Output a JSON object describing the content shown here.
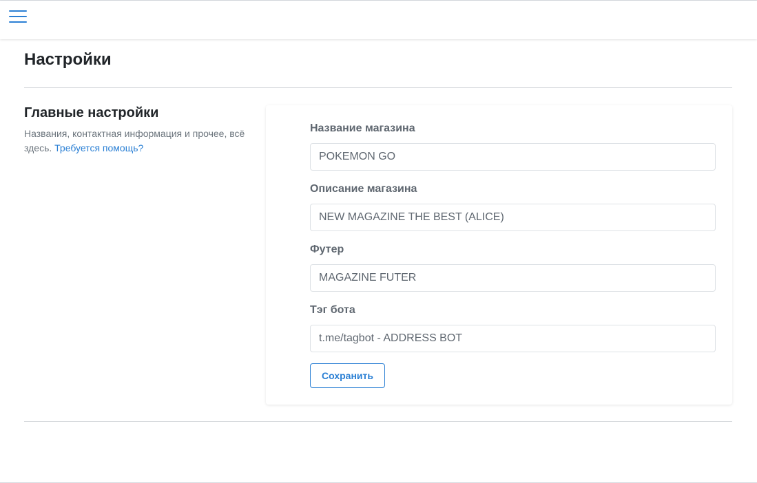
{
  "header": {
    "menu_icon": "hamburger-menu-icon"
  },
  "page": {
    "title": "Настройки"
  },
  "section": {
    "title": "Главные настройки",
    "description": "Названия, контактная информация и прочее, всё здесь.",
    "help_link": "Требуется помощь?"
  },
  "form": {
    "fields": [
      {
        "label": "Название магазина",
        "value": "POKEMON GO"
      },
      {
        "label": "Описание магазина",
        "value": "NEW MAGAZINE THE BEST (ALICE)"
      },
      {
        "label": "Футер",
        "value": "MAGAZINE FUTER"
      },
      {
        "label": "Тэг бота",
        "value": "t.me/tagbot - ADDRESS BOT"
      }
    ],
    "save_label": "Сохранить"
  },
  "colors": {
    "accent": "#2a7fd4",
    "label": "#5f6770",
    "muted": "#6c757d",
    "border": "#dde1e5"
  }
}
